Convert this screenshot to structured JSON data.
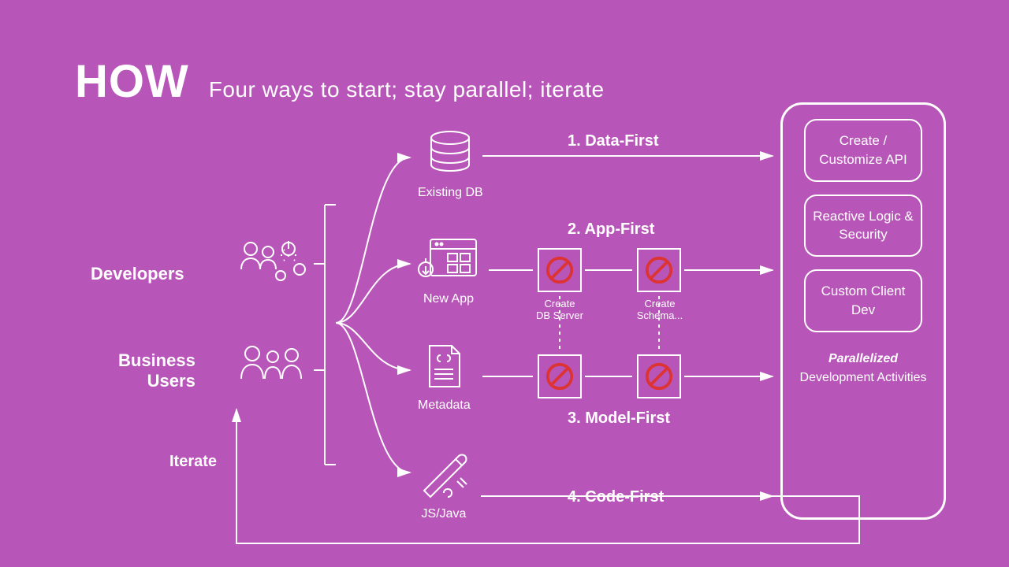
{
  "title": {
    "big": "HOW",
    "sub": "Four ways to start; stay parallel; iterate"
  },
  "roles": {
    "developers": "Developers",
    "business": "Business\nUsers"
  },
  "iterate": "Iterate",
  "paths": {
    "p1": {
      "label": "Existing DB",
      "approach": "1. Data-First"
    },
    "p2": {
      "label": "New App",
      "approach": "2. App-First"
    },
    "p3": {
      "label": "Metadata",
      "approach": "3. Model-First"
    },
    "p4": {
      "label": "JS/Java",
      "approach": "4. Code-First"
    }
  },
  "skips": {
    "create_db": "Create\nDB Server",
    "create_schema": "Create\nSchema..."
  },
  "activities": {
    "b1": "Create / Customize API",
    "b2": "Reactive Logic & Security",
    "b3": "Custom Client Dev",
    "caption_em": "Parallelized",
    "caption_rest": "Development Activities"
  }
}
